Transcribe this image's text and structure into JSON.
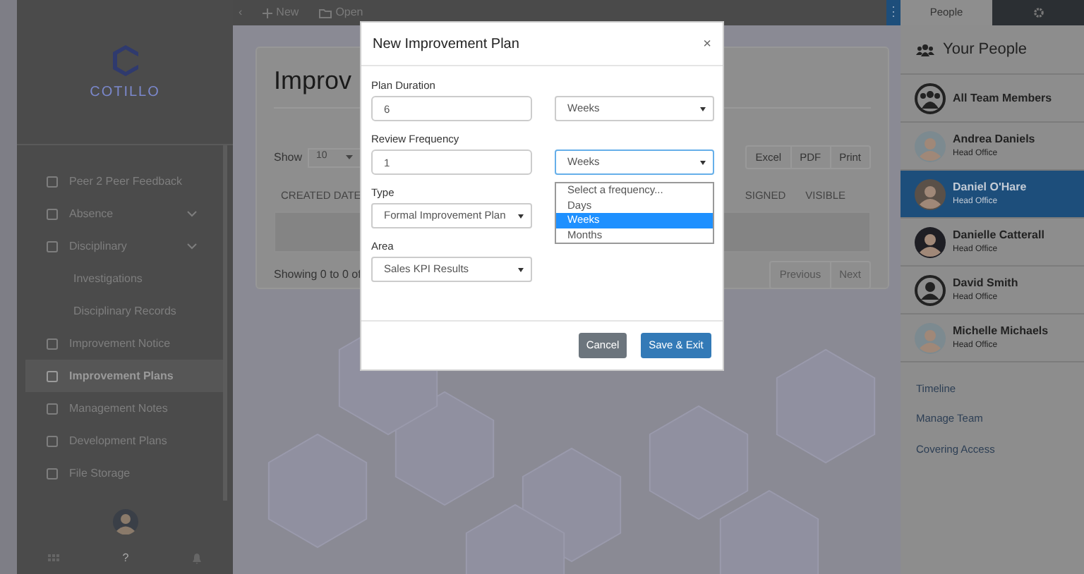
{
  "topbar": {
    "collapse": "‹",
    "buttons": [
      {
        "label": "New"
      },
      {
        "label": "Open"
      }
    ],
    "menu": "⋮"
  },
  "sidebar": {
    "logo": "COTILLO",
    "items": [
      {
        "label": "Peer 2 Peer Feedback",
        "selected": false
      },
      {
        "label": "Absence",
        "selected": false,
        "collapsible": true
      },
      {
        "label": "Disciplinary",
        "selected": false,
        "collapsible": true,
        "children": [
          {
            "label": "Investigations",
            "selected": false
          },
          {
            "label": "Disciplinary Records",
            "selected": false
          }
        ]
      },
      {
        "label": "Improvement Notice",
        "selected": false
      },
      {
        "label": "Improvement Plans",
        "selected": true
      },
      {
        "label": "Management Notes",
        "selected": false
      },
      {
        "label": "Development Plans",
        "selected": false
      },
      {
        "label": "File Storage",
        "selected": false
      }
    ],
    "footer": [
      "?"
    ]
  },
  "page": {
    "title": "Improv",
    "show_label": "Show",
    "page_size": "10",
    "export_buttons": [
      "Excel",
      "PDF",
      "Print"
    ],
    "columns": [
      "CREATED DATE",
      "SIGNED",
      "VISIBLE"
    ],
    "info": "Showing 0 to 0 of",
    "pager": [
      "Previous",
      "Next"
    ]
  },
  "modal": {
    "title": "New Improvement Plan",
    "close": "×",
    "fields": [
      {
        "label": "Plan Duration",
        "value": "6",
        "unit": "Weeks"
      },
      {
        "label": "Review Frequency",
        "value": "1",
        "unit": "Weeks",
        "open": true,
        "options": [
          {
            "label": "Select a frequency...",
            "selected": false
          },
          {
            "label": "Days",
            "selected": false
          },
          {
            "label": "Weeks",
            "selected": true
          },
          {
            "label": "Months",
            "selected": false
          }
        ]
      },
      {
        "label": "Type",
        "select": "Formal Improvement Plan"
      },
      {
        "label": "Area",
        "select": "Sales KPI Results"
      }
    ],
    "buttons": [
      {
        "label": "Cancel",
        "kind": "secondary"
      },
      {
        "label": "Save & Exit",
        "kind": "primary"
      }
    ]
  },
  "people_panel": {
    "tabs": [
      {
        "label": "People",
        "selected": true
      },
      {
        "kind": "settings",
        "selected": false
      }
    ],
    "heading": "Your People",
    "people": [
      {
        "name": "All Team Members",
        "kind": "group",
        "selected": false
      },
      {
        "name": "Andrea Daniels",
        "office": "Head Office",
        "kind": "photo",
        "selected": false
      },
      {
        "name": "Daniel O'Hare",
        "office": "Head Office",
        "kind": "photo",
        "selected": true
      },
      {
        "name": "Danielle Catterall",
        "office": "Head Office",
        "kind": "photo",
        "selected": false
      },
      {
        "name": "David Smith",
        "office": "Head Office",
        "kind": "placeholder",
        "selected": false
      },
      {
        "name": "Michelle Michaels",
        "office": "Head Office",
        "kind": "photo",
        "selected": false
      }
    ],
    "links": [
      "Timeline",
      "Manage Team",
      "Covering Access"
    ]
  }
}
